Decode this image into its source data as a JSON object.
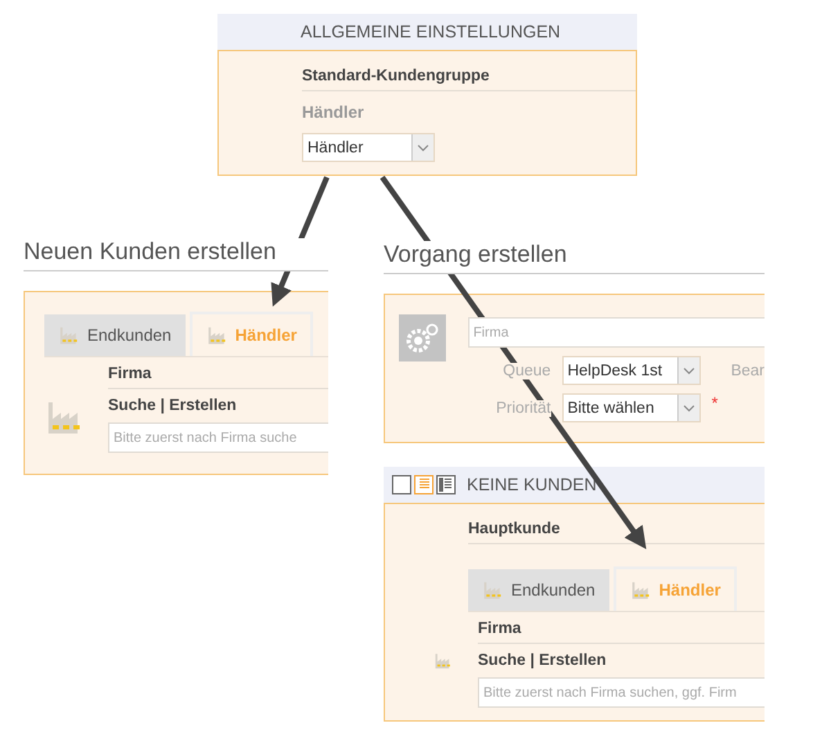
{
  "settings_panel": {
    "header": "ALLGEMEINE EINSTELLUNGEN",
    "field_label": "Standard-Kundengruppe",
    "current_value": "Händler",
    "select_value": "Händler"
  },
  "new_customer_panel": {
    "title": "Neuen Kunden erstellen",
    "tabs": [
      {
        "label": "Endkunden",
        "selected": false
      },
      {
        "label": "Händler",
        "selected": true
      }
    ],
    "company_label": "Firma",
    "company_actions": "Suche | Erstellen",
    "search_placeholder": "Bitte zuerst nach Firma suche"
  },
  "create_case_panel": {
    "title": "Vorgang erstellen",
    "company_placeholder": "Firma",
    "fields": [
      {
        "label": "Queue",
        "value": "HelpDesk 1st",
        "required": false
      },
      {
        "label": "Priorität",
        "value": "Bitte wählen",
        "required": true
      }
    ],
    "required_mark": "*",
    "cut_label": "Bear"
  },
  "customers_panel": {
    "header": "KEINE KUNDEN",
    "view_modes": [
      {
        "selected": false
      },
      {
        "selected": true
      },
      {
        "selected": false
      }
    ],
    "main_customer_label": "Hauptkunde",
    "tabs": [
      {
        "label": "Endkunden",
        "selected": false
      },
      {
        "label": "Händler",
        "selected": true
      }
    ],
    "company_label": "Firma",
    "company_actions": "Suche | Erstellen",
    "search_placeholder": "Bitte zuerst nach Firma suchen, ggf. Firm"
  }
}
